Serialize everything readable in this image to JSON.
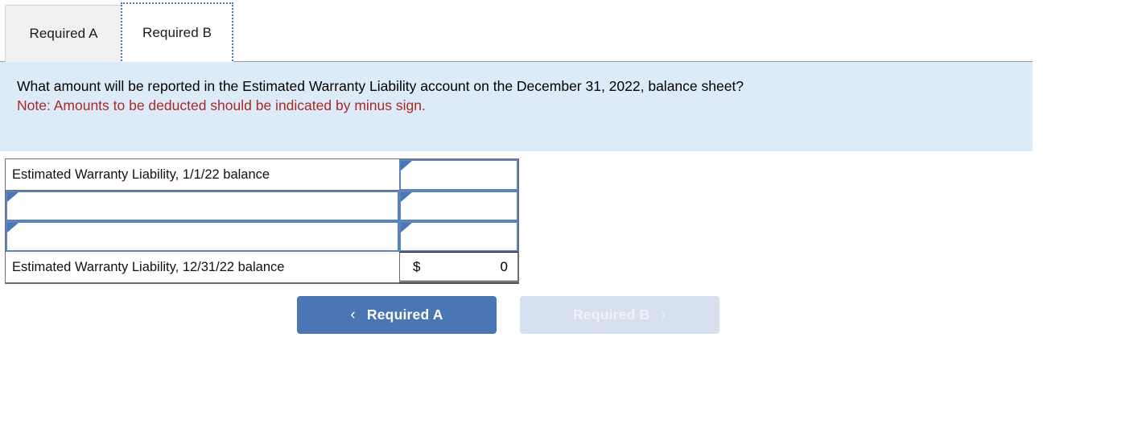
{
  "tabs": [
    {
      "label": "Required A",
      "state": "inactive"
    },
    {
      "label": "Required B",
      "state": "active"
    }
  ],
  "question": {
    "text": "What amount will be reported in the Estimated Warranty Liability account on the December 31, 2022, balance sheet?",
    "note": "Note: Amounts to be deducted should be indicated by minus sign.",
    "background_color": "#dcebf7",
    "note_color": "#a82a24"
  },
  "worksheet": {
    "rows": [
      {
        "label": "Estimated Warranty Liability, 1/1/22 balance",
        "label_type": "text",
        "amount": "",
        "amount_type": "dropdown"
      },
      {
        "label": "",
        "label_type": "dropdown",
        "amount": "",
        "amount_type": "dropdown"
      },
      {
        "label": "",
        "label_type": "dropdown",
        "amount": "",
        "amount_type": "dropdown"
      },
      {
        "label": "Estimated Warranty Liability, 12/31/22 balance",
        "label_type": "text",
        "amount": "0",
        "amount_currency": "$",
        "amount_type": "total"
      }
    ]
  },
  "navigation": {
    "prev": {
      "label": "Required A",
      "icon": "chevron-left",
      "glyph": "‹",
      "enabled": true,
      "color": "#4a77b4"
    },
    "next": {
      "label": "Required B",
      "icon": "chevron-right",
      "glyph": "›",
      "enabled": false,
      "color": "#d6e0ef"
    }
  }
}
